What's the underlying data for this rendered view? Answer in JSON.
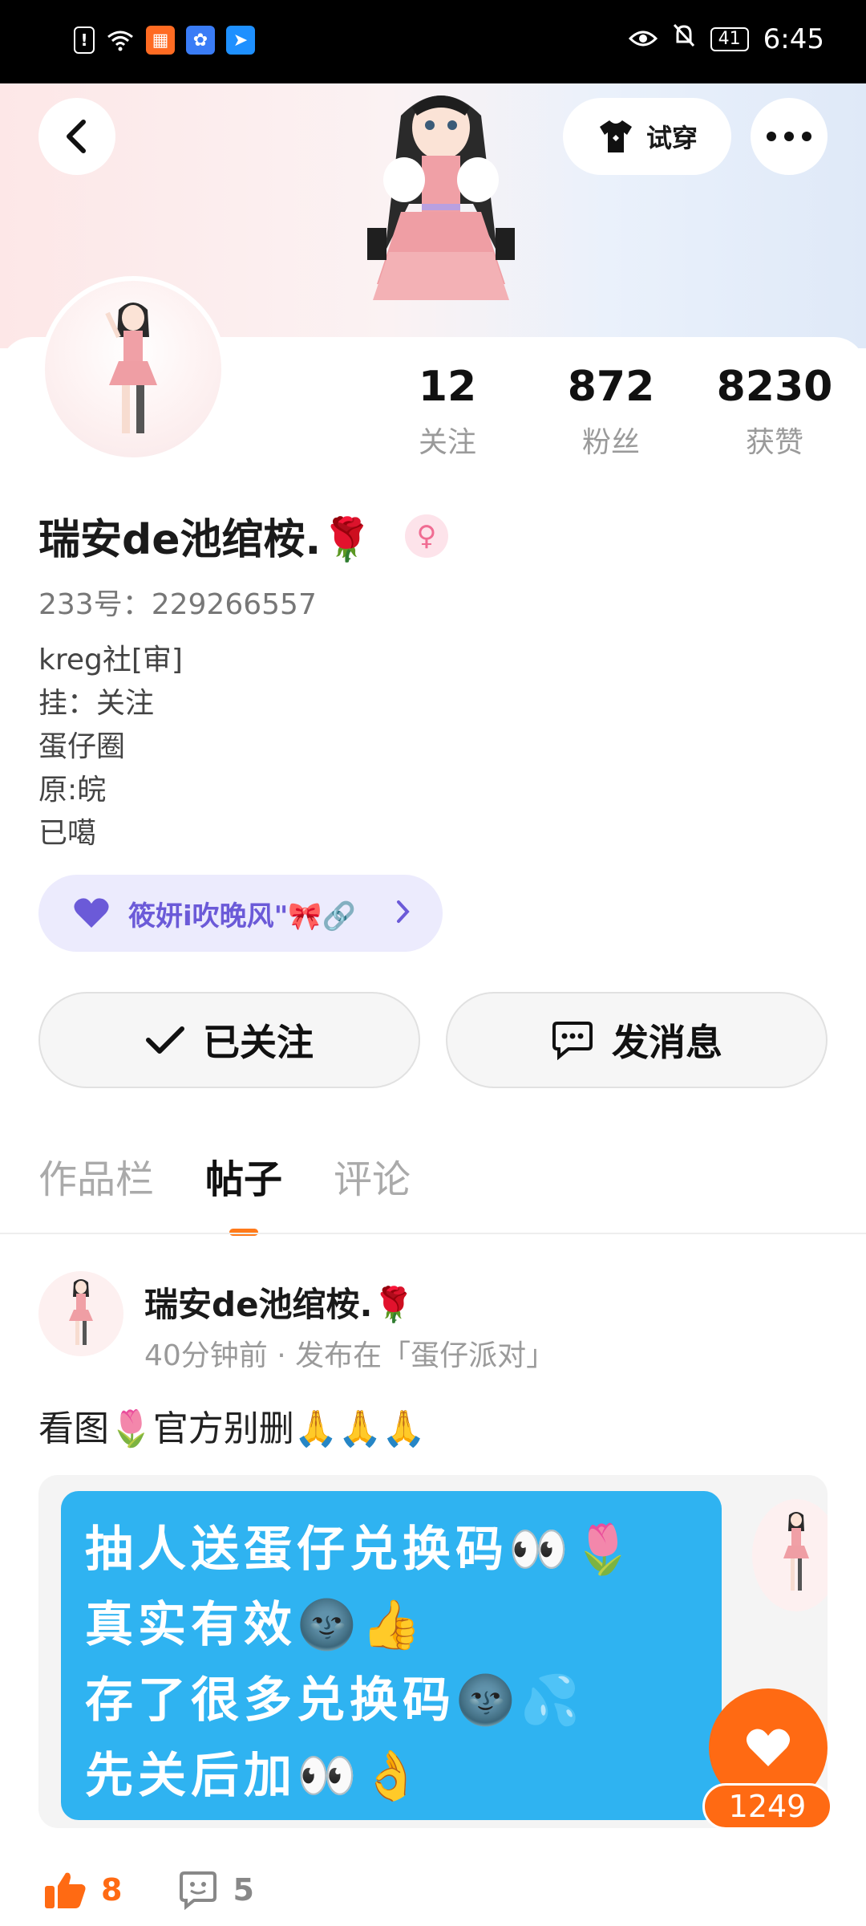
{
  "status_bar": {
    "time": "6:45",
    "battery": "41",
    "icons": [
      "alert-icon",
      "wifi-icon",
      "app-notification-icon",
      "baidu-icon",
      "app-icon",
      "eye-icon",
      "mute-icon",
      "battery-icon"
    ]
  },
  "header": {
    "tryon_label": "试穿"
  },
  "profile": {
    "stats": [
      {
        "value": "12",
        "label": "关注"
      },
      {
        "value": "872",
        "label": "粉丝"
      },
      {
        "value": "8230",
        "label": "获赞"
      }
    ],
    "name": "瑞安de池绾桉.🌹",
    "uid": "233号：229266557",
    "bio_lines": [
      "kreg社[审]",
      "挂：关注",
      "蛋仔圈",
      "原:皖",
      "已噶"
    ],
    "group_tag": "筱妍i吹晚风\"🎀🔗"
  },
  "actions": {
    "follow_label": "已关注",
    "message_label": "发消息"
  },
  "tabs": [
    {
      "label": "作品栏"
    },
    {
      "label": "帖子"
    },
    {
      "label": "评论"
    }
  ],
  "post": {
    "author": "瑞安de池绾桉.🌹",
    "meta": "40分钟前 · 发布在「蛋仔派对」",
    "text": "看图🌷官方别删🙏🙏🙏",
    "image_lines": [
      "抽人送蛋仔兑换码👀🌷",
      "真实有效🌚👍",
      "存了很多兑换码🌚💦",
      "先关后加👀👌"
    ],
    "fab_like_count": "1249",
    "likes": "8",
    "comments": "5"
  },
  "colors": {
    "accent": "#ff6a13",
    "group_tag_bg": "#ecebfd",
    "post_image_bg": "#2fb3f1"
  }
}
